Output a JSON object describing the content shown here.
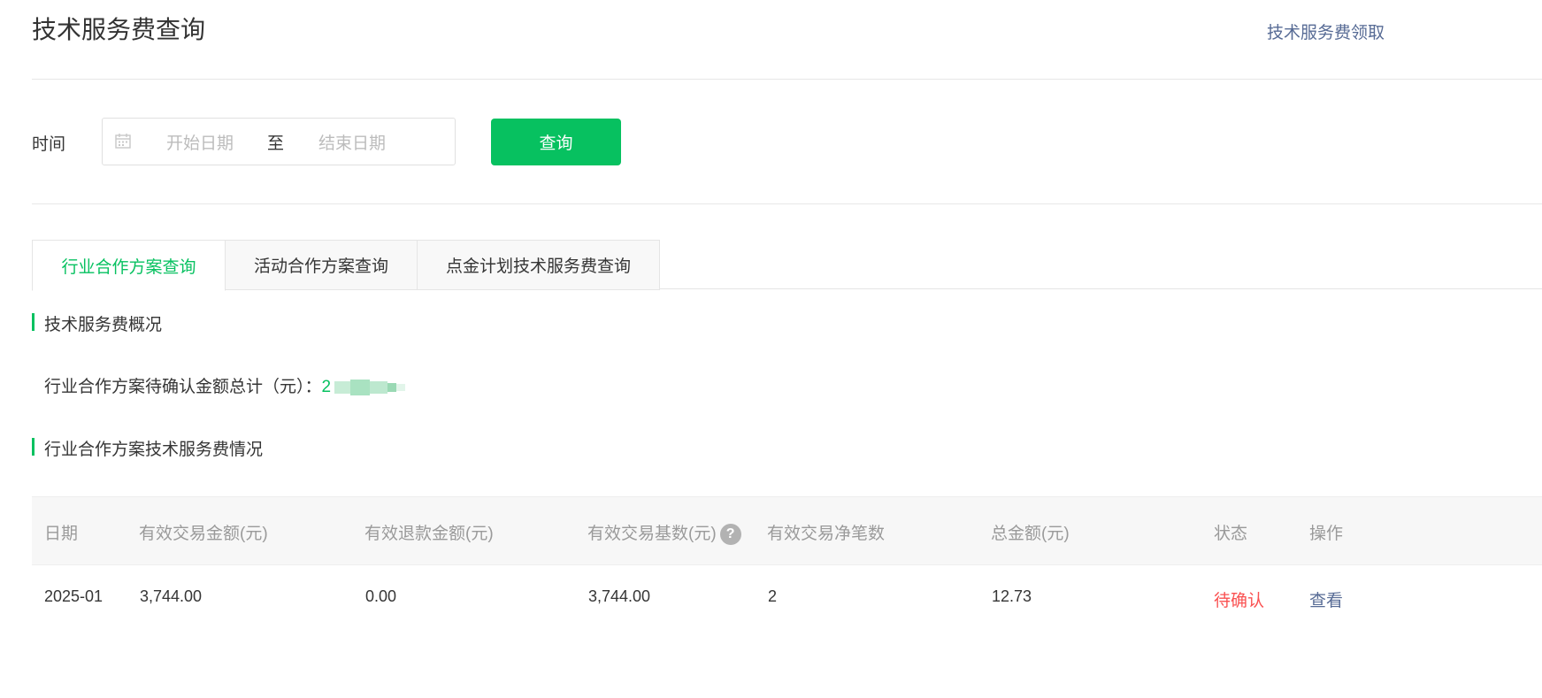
{
  "header": {
    "title": "技术服务费查询",
    "top_link": "技术服务费领取"
  },
  "filter": {
    "time_label": "时间",
    "start_placeholder": "开始日期",
    "separator": "至",
    "end_placeholder": "结束日期",
    "query_button": "查询",
    "calendar_icon": "calendar-icon"
  },
  "tabs": [
    {
      "label": "行业合作方案查询",
      "active": true
    },
    {
      "label": "活动合作方案查询",
      "active": false
    },
    {
      "label": "点金计划技术服务费查询",
      "active": false
    }
  ],
  "overview": {
    "title": "技术服务费概况",
    "pending_label": "行业合作方案待确认金额总计（元）：",
    "pending_value_visible": "2"
  },
  "detail": {
    "title": "行业合作方案技术服务费情况",
    "columns": [
      "日期",
      "有效交易金额(元)",
      "有效退款金额(元)",
      "有效交易基数(元)",
      "有效交易净笔数",
      "总金额(元)",
      "状态",
      "操作"
    ],
    "help_icon": "question-circle-icon",
    "rows": [
      {
        "date": "2025-01",
        "trade_amount": "3,744.00",
        "refund_amount": "0.00",
        "trade_base": "3,744.00",
        "net_count": "2",
        "total": "12.73",
        "status": "待确认",
        "action": "查看"
      }
    ]
  },
  "colors": {
    "accent": "#07c160",
    "link": "#576b95",
    "status_pending": "#fa5151"
  }
}
